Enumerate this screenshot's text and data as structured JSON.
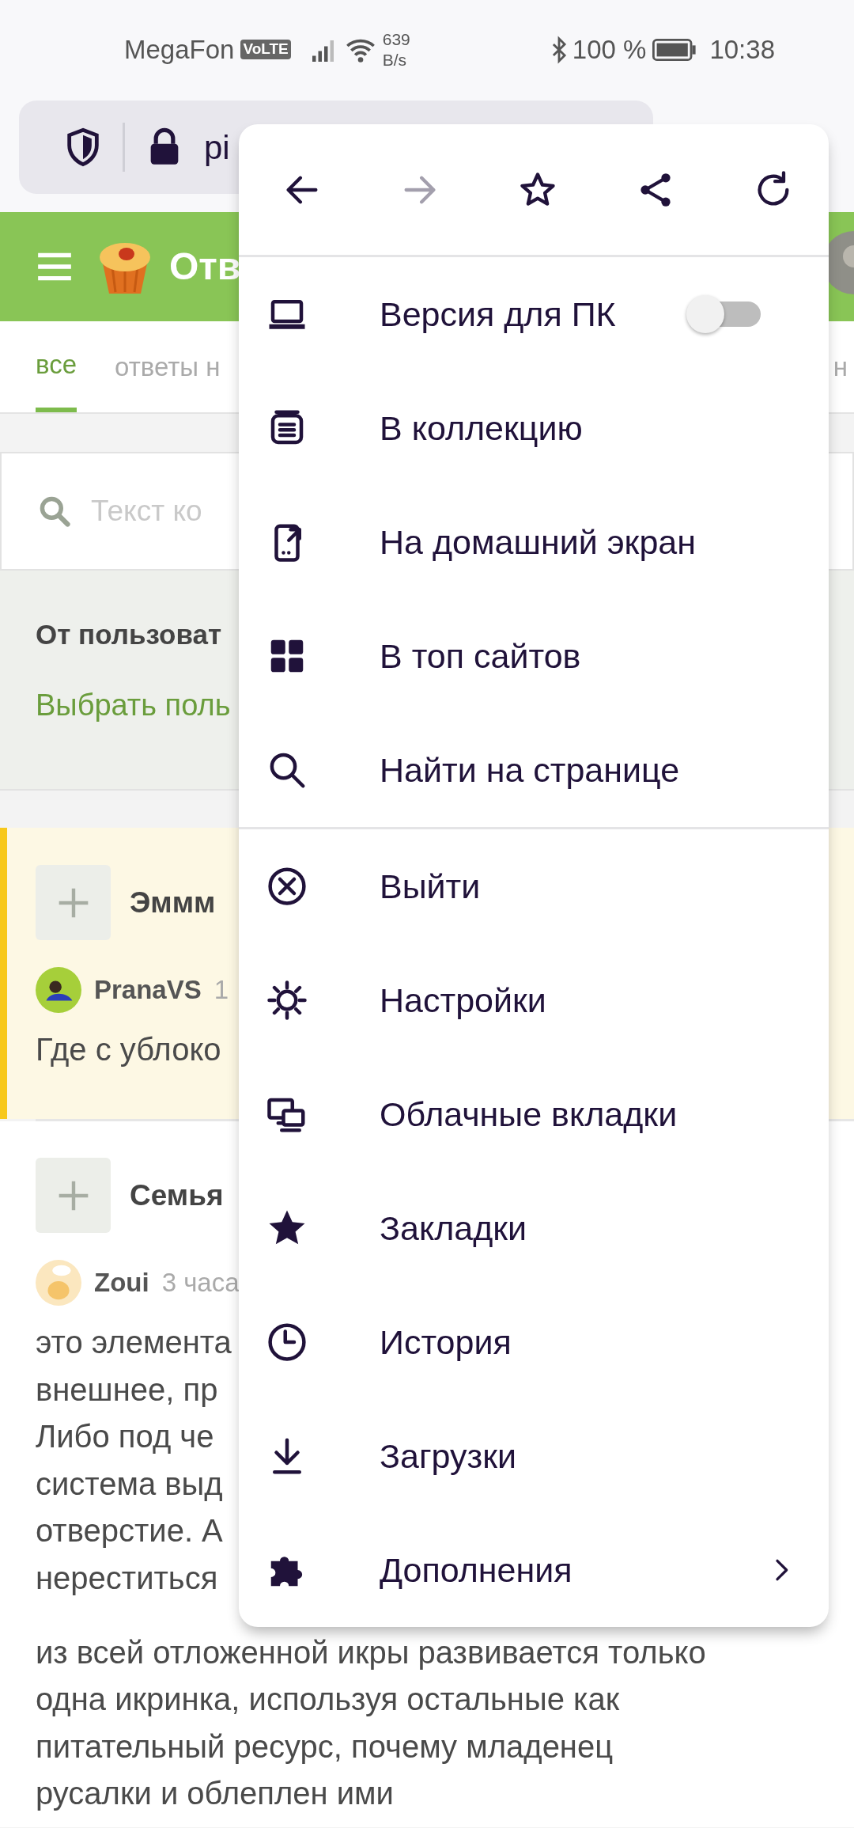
{
  "status_bar": {
    "carrier": "MegaFon",
    "volte": "VoLTE",
    "speed_value": "639",
    "speed_unit": "B/s",
    "battery": "100 %",
    "time": "10:38"
  },
  "url_bar": {
    "url": "pi"
  },
  "site_header": {
    "title": "Отв"
  },
  "tabs": [
    {
      "label": "все",
      "selected": true
    },
    {
      "label": "ответы н",
      "selected": false
    },
    {
      "label": "н",
      "selected": false
    }
  ],
  "search": {
    "placeholder": "Текст ко"
  },
  "filter": {
    "title": "От пользоват",
    "link": "Выбрать поль"
  },
  "posts": [
    {
      "title": "Эммм",
      "author": "PranaVS",
      "time": "1",
      "highlighted": true,
      "lines": [
        "Где с ублоко"
      ]
    },
    {
      "title": "Семья",
      "author": "Zoui",
      "time": "3 часа",
      "highlighted": false,
      "lines": [
        "это элемента",
        "внешнее, пр",
        "Либо под че",
        "система выд",
        "отверстие. А",
        "нереститься"
      ],
      "more_lines": [
        "из всей отложенной икры развивается только",
        "одна икринка, используя остальные как",
        "питательный ресурс, почему младенец",
        "русалки и облеплен ими"
      ]
    }
  ],
  "menu": {
    "toolbar": [
      {
        "disabled": false
      },
      {
        "disabled": true
      },
      {
        "disabled": false
      },
      {
        "disabled": false
      },
      {
        "disabled": false
      }
    ],
    "groups": [
      [
        {
          "kind": "toggle",
          "label": "Версия для ПК",
          "on": false
        },
        {
          "kind": "plain",
          "label": "В коллекцию"
        },
        {
          "kind": "plain",
          "label": "На домашний экран"
        },
        {
          "kind": "plain",
          "label": "В топ сайтов"
        },
        {
          "kind": "plain",
          "label": "Найти на странице"
        }
      ],
      [
        {
          "kind": "plain",
          "label": "Выйти"
        },
        {
          "kind": "plain",
          "label": "Настройки"
        },
        {
          "kind": "plain",
          "label": "Облачные вкладки"
        },
        {
          "kind": "plain",
          "label": "Закладки"
        },
        {
          "kind": "plain",
          "label": "История"
        },
        {
          "kind": "plain",
          "label": "Загрузки"
        },
        {
          "kind": "submenu",
          "label": "Дополнения"
        }
      ]
    ]
  }
}
